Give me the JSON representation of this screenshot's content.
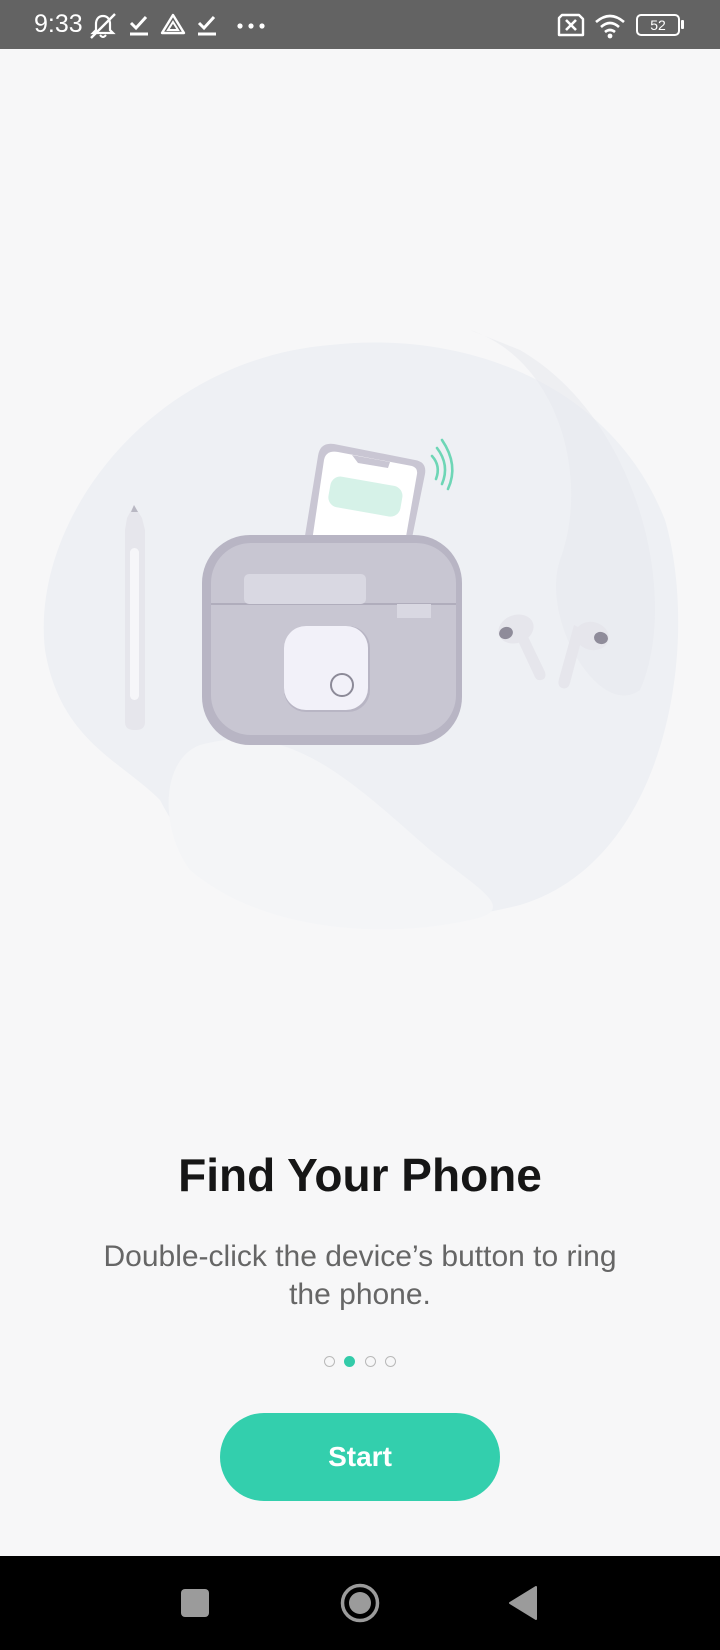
{
  "status_bar": {
    "time": "9:33",
    "battery_level": "52",
    "icons": [
      "mute-icon",
      "check-icon",
      "drive-icon",
      "check-icon",
      "more-dots-icon",
      "no-sim-icon",
      "wifi-icon",
      "battery-icon"
    ]
  },
  "onboarding": {
    "title": "Find Your Phone",
    "description": "Double-click the device’s button to ring the phone.",
    "pager": {
      "total": 4,
      "current": 2
    },
    "start_button_label": "Start"
  },
  "nav_bar": {
    "buttons": [
      "recents-square-icon",
      "home-circle-icon",
      "back-triangle-icon"
    ]
  },
  "colors": {
    "accent": "#33cfad",
    "status_bar_bg": "#636363",
    "background": "#f7f7f8",
    "title_text": "#161616",
    "description_text": "#666666",
    "nav_bar_bg": "#000000"
  }
}
